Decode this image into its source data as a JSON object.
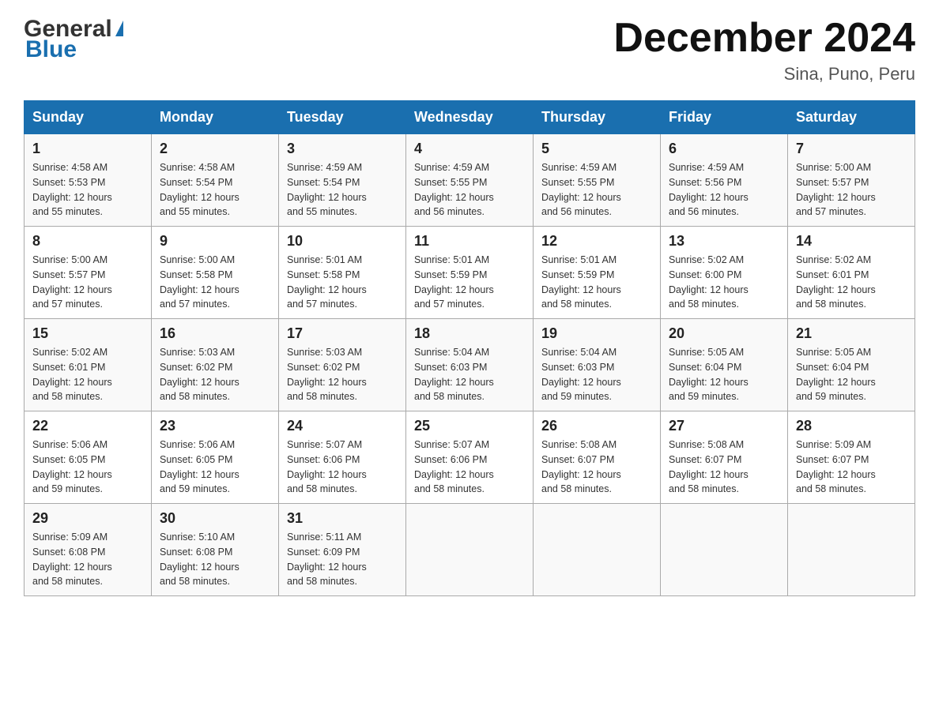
{
  "header": {
    "logo": {
      "general": "General",
      "blue": "Blue",
      "triangle": "▲"
    },
    "title": "December 2024",
    "location": "Sina, Puno, Peru"
  },
  "calendar": {
    "weekdays": [
      "Sunday",
      "Monday",
      "Tuesday",
      "Wednesday",
      "Thursday",
      "Friday",
      "Saturday"
    ],
    "weeks": [
      [
        {
          "day": "1",
          "sunrise": "4:58 AM",
          "sunset": "5:53 PM",
          "daylight": "12 hours and 55 minutes."
        },
        {
          "day": "2",
          "sunrise": "4:58 AM",
          "sunset": "5:54 PM",
          "daylight": "12 hours and 55 minutes."
        },
        {
          "day": "3",
          "sunrise": "4:59 AM",
          "sunset": "5:54 PM",
          "daylight": "12 hours and 55 minutes."
        },
        {
          "day": "4",
          "sunrise": "4:59 AM",
          "sunset": "5:55 PM",
          "daylight": "12 hours and 56 minutes."
        },
        {
          "day": "5",
          "sunrise": "4:59 AM",
          "sunset": "5:55 PM",
          "daylight": "12 hours and 56 minutes."
        },
        {
          "day": "6",
          "sunrise": "4:59 AM",
          "sunset": "5:56 PM",
          "daylight": "12 hours and 56 minutes."
        },
        {
          "day": "7",
          "sunrise": "5:00 AM",
          "sunset": "5:57 PM",
          "daylight": "12 hours and 57 minutes."
        }
      ],
      [
        {
          "day": "8",
          "sunrise": "5:00 AM",
          "sunset": "5:57 PM",
          "daylight": "12 hours and 57 minutes."
        },
        {
          "day": "9",
          "sunrise": "5:00 AM",
          "sunset": "5:58 PM",
          "daylight": "12 hours and 57 minutes."
        },
        {
          "day": "10",
          "sunrise": "5:01 AM",
          "sunset": "5:58 PM",
          "daylight": "12 hours and 57 minutes."
        },
        {
          "day": "11",
          "sunrise": "5:01 AM",
          "sunset": "5:59 PM",
          "daylight": "12 hours and 57 minutes."
        },
        {
          "day": "12",
          "sunrise": "5:01 AM",
          "sunset": "5:59 PM",
          "daylight": "12 hours and 58 minutes."
        },
        {
          "day": "13",
          "sunrise": "5:02 AM",
          "sunset": "6:00 PM",
          "daylight": "12 hours and 58 minutes."
        },
        {
          "day": "14",
          "sunrise": "5:02 AM",
          "sunset": "6:01 PM",
          "daylight": "12 hours and 58 minutes."
        }
      ],
      [
        {
          "day": "15",
          "sunrise": "5:02 AM",
          "sunset": "6:01 PM",
          "daylight": "12 hours and 58 minutes."
        },
        {
          "day": "16",
          "sunrise": "5:03 AM",
          "sunset": "6:02 PM",
          "daylight": "12 hours and 58 minutes."
        },
        {
          "day": "17",
          "sunrise": "5:03 AM",
          "sunset": "6:02 PM",
          "daylight": "12 hours and 58 minutes."
        },
        {
          "day": "18",
          "sunrise": "5:04 AM",
          "sunset": "6:03 PM",
          "daylight": "12 hours and 58 minutes."
        },
        {
          "day": "19",
          "sunrise": "5:04 AM",
          "sunset": "6:03 PM",
          "daylight": "12 hours and 59 minutes."
        },
        {
          "day": "20",
          "sunrise": "5:05 AM",
          "sunset": "6:04 PM",
          "daylight": "12 hours and 59 minutes."
        },
        {
          "day": "21",
          "sunrise": "5:05 AM",
          "sunset": "6:04 PM",
          "daylight": "12 hours and 59 minutes."
        }
      ],
      [
        {
          "day": "22",
          "sunrise": "5:06 AM",
          "sunset": "6:05 PM",
          "daylight": "12 hours and 59 minutes."
        },
        {
          "day": "23",
          "sunrise": "5:06 AM",
          "sunset": "6:05 PM",
          "daylight": "12 hours and 59 minutes."
        },
        {
          "day": "24",
          "sunrise": "5:07 AM",
          "sunset": "6:06 PM",
          "daylight": "12 hours and 58 minutes."
        },
        {
          "day": "25",
          "sunrise": "5:07 AM",
          "sunset": "6:06 PM",
          "daylight": "12 hours and 58 minutes."
        },
        {
          "day": "26",
          "sunrise": "5:08 AM",
          "sunset": "6:07 PM",
          "daylight": "12 hours and 58 minutes."
        },
        {
          "day": "27",
          "sunrise": "5:08 AM",
          "sunset": "6:07 PM",
          "daylight": "12 hours and 58 minutes."
        },
        {
          "day": "28",
          "sunrise": "5:09 AM",
          "sunset": "6:07 PM",
          "daylight": "12 hours and 58 minutes."
        }
      ],
      [
        {
          "day": "29",
          "sunrise": "5:09 AM",
          "sunset": "6:08 PM",
          "daylight": "12 hours and 58 minutes."
        },
        {
          "day": "30",
          "sunrise": "5:10 AM",
          "sunset": "6:08 PM",
          "daylight": "12 hours and 58 minutes."
        },
        {
          "day": "31",
          "sunrise": "5:11 AM",
          "sunset": "6:09 PM",
          "daylight": "12 hours and 58 minutes."
        },
        null,
        null,
        null,
        null
      ]
    ],
    "labels": {
      "sunrise": "Sunrise:",
      "sunset": "Sunset:",
      "daylight": "Daylight: 12 hours"
    }
  }
}
